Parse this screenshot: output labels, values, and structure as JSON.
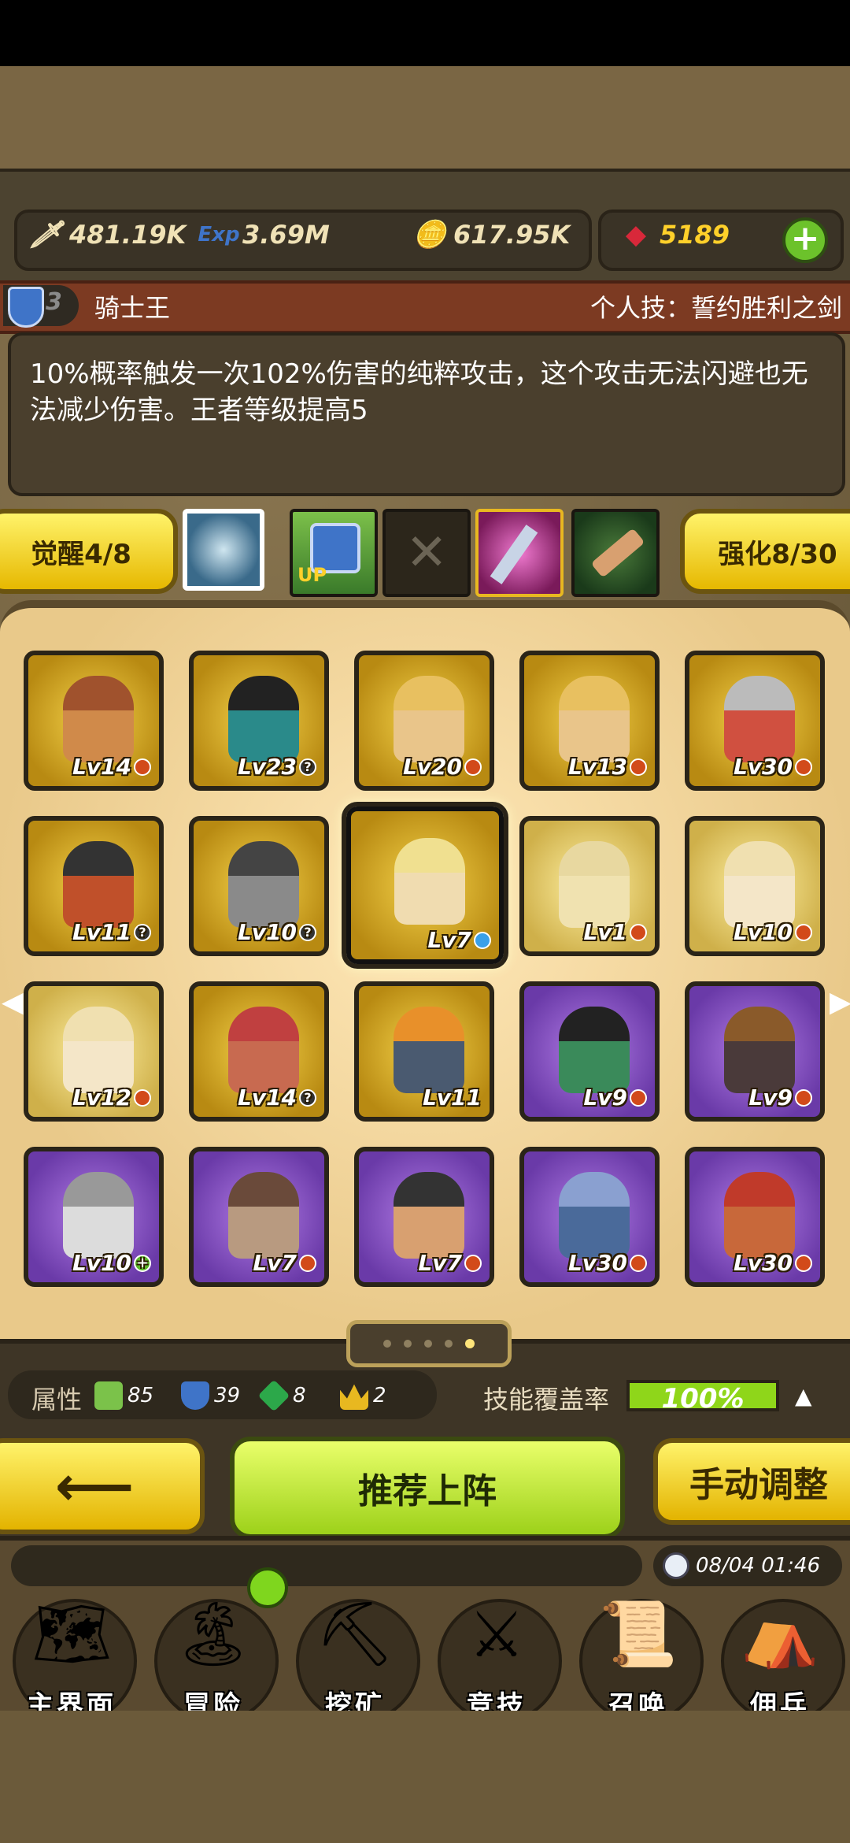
{
  "resources": {
    "attack": {
      "icon": "sword-icon",
      "value": "481.19K"
    },
    "exp": {
      "icon": "exp-icon",
      "value": "3.69M"
    },
    "gold": {
      "icon": "gold-coin-icon",
      "value": "617.95K"
    },
    "gems": {
      "icon": "ruby-icon",
      "value": "5189"
    }
  },
  "hero": {
    "rank": "3",
    "name": "骑士王",
    "skill_title": "个人技：誓约胜利之剑",
    "description": "10%概率触发一次102%伤害的纯粹攻击，这个攻击无法闪避也无法减少伤害。王者等级提高5"
  },
  "awaken_label": "觉醒4/8",
  "enhance_label": "强化8/30",
  "skill_slots": [
    "magic-circle-icon",
    "shield-up-icon",
    "empty-slot-icon",
    "sword-skill-icon",
    "scroll-skill-icon"
  ],
  "cards": [
    {
      "tier": "gold",
      "lv": "Lv14",
      "badge": "red",
      "skin": "#d08a4a",
      "hair": "#a0522d"
    },
    {
      "tier": "gold",
      "lv": "Lv23",
      "badge": "q",
      "skin": "#2a8a8a",
      "hair": "#222"
    },
    {
      "tier": "gold",
      "lv": "Lv20",
      "badge": "red",
      "skin": "#e9c58a",
      "hair": "#e8c060"
    },
    {
      "tier": "gold",
      "lv": "Lv13",
      "badge": "red",
      "skin": "#e9c58a",
      "hair": "#e8c060"
    },
    {
      "tier": "gold",
      "lv": "Lv30",
      "badge": "red",
      "skin": "#d05040",
      "hair": "#bbbbbb"
    },
    {
      "tier": "gold",
      "lv": "Lv11",
      "badge": "q",
      "skin": "#c0502a",
      "hair": "#333"
    },
    {
      "tier": "gold",
      "lv": "Lv10",
      "badge": "q",
      "skin": "#8a8a8a",
      "hair": "#444"
    },
    {
      "tier": "gold",
      "lv": "Lv7",
      "badge": "star",
      "skin": "#f0dcb0",
      "hair": "#f0e090",
      "selected": true
    },
    {
      "tier": "gold pale",
      "lv": "Lv1",
      "badge": "red",
      "skin": "#f0e2b0",
      "hair": "#e8d8a0"
    },
    {
      "tier": "gold pale",
      "lv": "Lv10",
      "badge": "red",
      "skin": "#f4e6c8",
      "hair": "#f0e0b0"
    },
    {
      "tier": "gold pale",
      "lv": "Lv12",
      "badge": "red",
      "skin": "#f4e6c8",
      "hair": "#f0e0b0"
    },
    {
      "tier": "gold",
      "lv": "Lv14",
      "badge": "q",
      "skin": "#c86a50",
      "hair": "#c04040"
    },
    {
      "tier": "gold",
      "lv": "Lv11",
      "badge": "",
      "skin": "#4a5a70",
      "hair": "#e8902a"
    },
    {
      "tier": "purple",
      "lv": "Lv9",
      "badge": "red",
      "skin": "#3a8a5a",
      "hair": "#222"
    },
    {
      "tier": "purple",
      "lv": "Lv9",
      "badge": "red",
      "skin": "#4a3a3a",
      "hair": "#8a5a2a"
    },
    {
      "tier": "purple",
      "lv": "Lv10",
      "badge": "plus",
      "skin": "#dcdcdc",
      "hair": "#999"
    },
    {
      "tier": "purple",
      "lv": "Lv7",
      "badge": "red",
      "skin": "#b89a80",
      "hair": "#6a4a3a"
    },
    {
      "tier": "purple",
      "lv": "Lv7",
      "badge": "red",
      "skin": "#d8a070",
      "hair": "#333"
    },
    {
      "tier": "purple",
      "lv": "Lv30",
      "badge": "red",
      "skin": "#4a6a9a",
      "hair": "#8aa0d0"
    },
    {
      "tier": "purple",
      "lv": "Lv30",
      "badge": "red",
      "skin": "#c8683a",
      "hair": "#c03a2a"
    }
  ],
  "pager": {
    "total": 5,
    "active": 5
  },
  "attributes": {
    "label": "属性",
    "items": [
      {
        "icon": "sword-attr-icon",
        "value": "85",
        "color": "#7bc24a"
      },
      {
        "icon": "shield-attr-icon",
        "value": "39",
        "color": "#3f74c8"
      },
      {
        "icon": "gem-attr-icon",
        "value": "8",
        "color": "#2ca84a"
      },
      {
        "icon": "crown-attr-icon",
        "value": "2",
        "color": "#e8b820"
      }
    ]
  },
  "coverage": {
    "label": "技能覆盖率",
    "value": "100%",
    "fraction": 1.0
  },
  "buttons": {
    "back": "⟵",
    "recommend": "推荐上阵",
    "manual": "手动调整"
  },
  "datetime": "08/04 01:46",
  "nav": [
    {
      "label": "主界面",
      "icon": "map-scroll-icon",
      "glyph": "🗺"
    },
    {
      "label": "冒险",
      "icon": "island-icon",
      "glyph": "🏝"
    },
    {
      "label": "挖矿",
      "icon": "pickaxe-icon",
      "glyph": "⛏"
    },
    {
      "label": "竞技",
      "icon": "crossed-swords-icon",
      "glyph": "⚔"
    },
    {
      "label": "召唤",
      "icon": "summon-scroll-icon",
      "glyph": "📜"
    },
    {
      "label": "佣兵",
      "icon": "tent-icon",
      "glyph": "⛺"
    }
  ]
}
